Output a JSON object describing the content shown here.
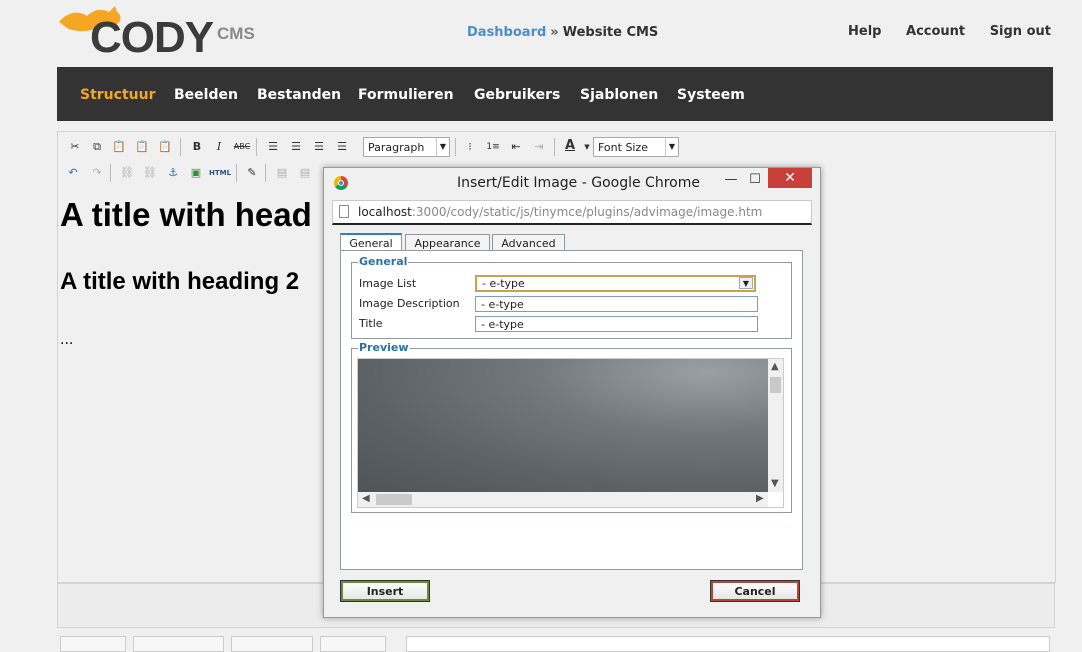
{
  "header": {
    "logo_text": "CODY",
    "logo_suffix": "CMS",
    "breadcrumb": {
      "link": "Dashboard",
      "separator": "»",
      "current": "Website CMS"
    },
    "links": [
      "Help",
      "Account",
      "Sign out"
    ]
  },
  "nav": {
    "items": [
      "Structuur",
      "Beelden",
      "Bestanden",
      "Formulieren",
      "Gebruikers",
      "Sjablonen",
      "Systeem"
    ],
    "active": "Structuur"
  },
  "editor": {
    "format_select": "Paragraph",
    "font_size_select": "Font Size",
    "html_button": "HTML",
    "heading1": "A title with head",
    "heading2": "A title with heading 2",
    "body_text": "..."
  },
  "dialog": {
    "title": "Insert/Edit Image - Google Chrome",
    "url_host": "localhost",
    "url_path": ":3000/cody/static/js/tinymce/plugins/advimage/image.htm",
    "tabs": [
      "General",
      "Appearance",
      "Advanced"
    ],
    "active_tab": "General",
    "general": {
      "legend": "General",
      "image_list_label": "Image List",
      "image_list_value": "- e-type",
      "description_label": "Image Description",
      "description_value": "- e-type",
      "title_label": "Title",
      "title_value": "- e-type"
    },
    "preview_legend": "Preview",
    "insert_label": "Insert",
    "cancel_label": "Cancel"
  },
  "colors": {
    "accent": "#f5a623",
    "nav_bg": "#333333",
    "link": "#4a8ec8",
    "close": "#c7403a"
  }
}
